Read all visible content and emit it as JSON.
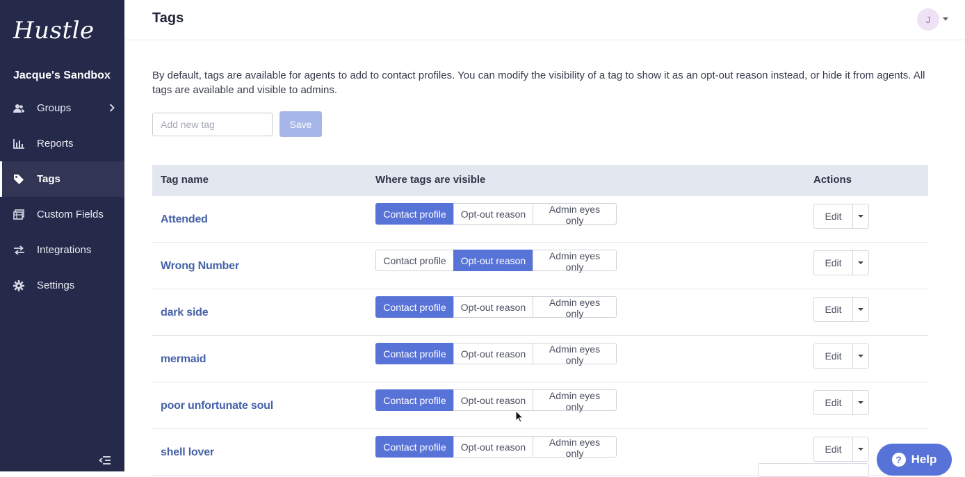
{
  "sidebar": {
    "logo": "Hustle",
    "workspace": "Jacque's Sandbox",
    "items": [
      {
        "label": "Groups",
        "icon": "people-icon",
        "has_chevron": true
      },
      {
        "label": "Reports",
        "icon": "bar-chart-icon"
      },
      {
        "label": "Tags",
        "icon": "tag-icon",
        "active": true
      },
      {
        "label": "Custom Fields",
        "icon": "table-icon"
      },
      {
        "label": "Integrations",
        "icon": "swap-arrows-icon"
      },
      {
        "label": "Settings",
        "icon": "gear-icon"
      }
    ]
  },
  "header": {
    "title": "Tags",
    "avatar_initial": "J"
  },
  "description": "By default, tags are available for agents to add to contact profiles. You can modify the visibility of a tag to show it as an opt-out reason instead, or hide it from agents. All tags are available and visible to admins.",
  "new_tag": {
    "placeholder": "Add new tag",
    "save_label": "Save"
  },
  "table": {
    "headers": {
      "name": "Tag name",
      "visibility": "Where tags are visible",
      "actions": "Actions"
    },
    "options": [
      "Contact profile",
      "Opt-out reason",
      "Admin eyes only"
    ],
    "edit_label": "Edit",
    "rows": [
      {
        "name": "Attended",
        "selected": "Contact profile"
      },
      {
        "name": "Wrong Number",
        "selected": "Opt-out reason"
      },
      {
        "name": "dark side",
        "selected": "Contact profile"
      },
      {
        "name": "mermaid",
        "selected": "Contact profile"
      },
      {
        "name": "poor unfortunate soul",
        "selected": "Contact profile"
      },
      {
        "name": "shell lover",
        "selected": "Contact profile"
      }
    ]
  },
  "help": {
    "label": "Help",
    "icon_glyph": "?"
  },
  "colors": {
    "sidebar_bg": "#262a4a",
    "accent": "#5873d8",
    "tag_link": "#4661a8",
    "header_row_bg": "#e3e7ef"
  }
}
